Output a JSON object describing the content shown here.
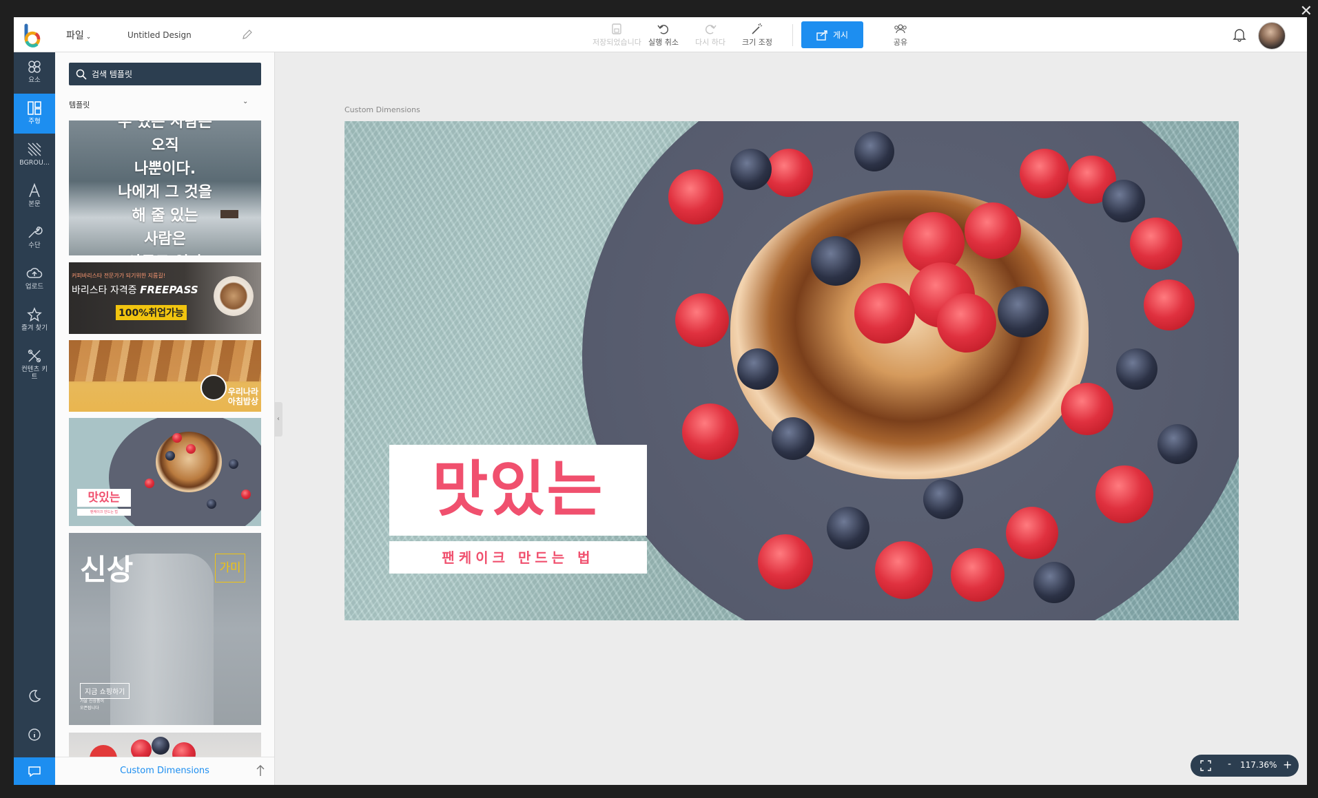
{
  "header": {
    "file_menu": "파일",
    "doc_title": "Untitled Design",
    "tools": [
      {
        "label": "저장되었습니다",
        "icon": "save-icon"
      },
      {
        "label": "실행 취소",
        "icon": "undo-icon"
      },
      {
        "label": "다시 하다",
        "icon": "redo-icon"
      },
      {
        "label": "크기 조정",
        "icon": "magic-wand-icon"
      }
    ],
    "publish_label": "게시",
    "share_label": "공유"
  },
  "rail": {
    "items": [
      {
        "label": "요소",
        "icon": "elements-icon"
      },
      {
        "label": "주형",
        "icon": "templates-icon"
      },
      {
        "label": "BGROU...",
        "icon": "background-icon"
      },
      {
        "label": "본문",
        "icon": "text-icon"
      },
      {
        "label": "수단",
        "icon": "tools-icon"
      },
      {
        "label": "업로드",
        "icon": "upload-icon"
      },
      {
        "label": "즐겨 찾기",
        "icon": "star-icon"
      },
      {
        "label": "컨텐츠 키트",
        "icon": "content-kit-icon"
      }
    ]
  },
  "panel": {
    "search_placeholder": "검색 템플릿",
    "section_label": "템플릿",
    "footer_label": "Custom Dimensions",
    "thumbs": {
      "t1_text": "수 있는 사람은\n오직\n나뿐이다.\n나에게 그 것을\n해 줄 있는\n사람은\n아무도 없다",
      "t2_small": "커피바리스타 전문가가 되기위한 지름길!",
      "t2_main": "바리스타 자격증",
      "t2_main_bold": "FREEPASS",
      "t2_badge": "100%취업가능",
      "t3_title": "우리나라\n아침밥상",
      "t4_title": "맛있는",
      "t4_sub": "팬케이크 만드는 법",
      "t5_big": "신상",
      "t5_tag": "가미",
      "t5_shop": "지금 쇼핑하기",
      "t5_sub": "가을 신상품이\n오픈됩니다"
    }
  },
  "canvas": {
    "label": "Custom Dimensions",
    "headline": "맛있는",
    "subline": "팬케이크 만드는 법"
  },
  "zoom": {
    "value": "117.36%",
    "minus": "-",
    "plus": "+"
  },
  "colors": {
    "accent": "#1d8ef0",
    "rail": "#2c3e50",
    "headline": "#f0506e"
  }
}
